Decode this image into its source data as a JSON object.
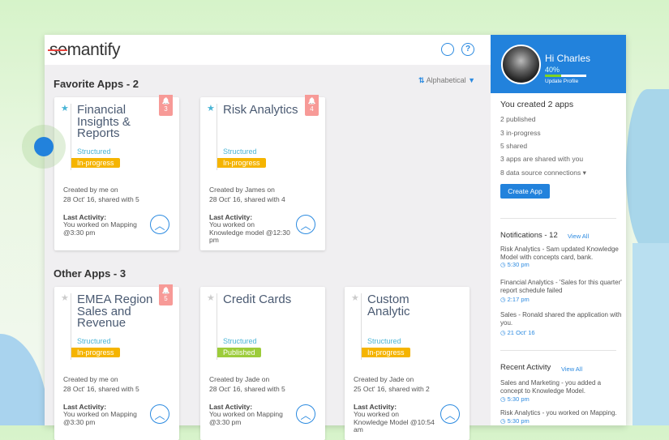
{
  "app": {
    "logo": "semantify",
    "logo_prefix": "se",
    "logo_suffix": "mantify"
  },
  "header": {
    "search_icon": "search-icon",
    "help_icon": "help-icon"
  },
  "favorites": {
    "title": "Favorite Apps - 2",
    "sort_label": "Alphabetical"
  },
  "other": {
    "title": "Other Apps - 3"
  },
  "colors": {
    "accent": "#2282dc",
    "inprogress": "#f5b400",
    "published": "#9ccc3a",
    "bell": "#f79a97"
  },
  "favorite_cards": [
    {
      "title": "Financial Insights & Reports",
      "type": "Structured",
      "status": "In-progress",
      "bell": "3",
      "created1": "Created by me on",
      "created2": "28 Oct' 16, shared with 5",
      "last_label": "Last Activity:",
      "last": "You worked on Mapping @3:30 pm",
      "starred": true
    },
    {
      "title": "Risk Analytics",
      "type": "Structured",
      "status": "In-progress",
      "bell": "4",
      "created1": "Created by James on",
      "created2": "28 Oct' 16, shared with 4",
      "last_label": "Last Activity:",
      "last": "You worked on Knowledge model @12:30 pm",
      "starred": true
    }
  ],
  "other_cards": [
    {
      "title": "EMEA Region Sales and Revenue",
      "type": "Structured",
      "status": "In-progress",
      "bell": "5",
      "created1": "Created by me on",
      "created2": "28 Oct' 16, shared with 5",
      "last_label": "Last Activity:",
      "last": "You worked on Mapping @3:30 pm",
      "starred": false
    },
    {
      "title": "Credit Cards",
      "type": "Structured",
      "status": "Published",
      "bell": null,
      "created1": "Created by Jade on",
      "created2": "28 Oct' 16, shared with 5",
      "last_label": "Last Activity:",
      "last": "You worked on Mapping @3:30 pm",
      "starred": false
    },
    {
      "title": "Custom Analytic",
      "type": "Structured",
      "status": "In-progress",
      "bell": null,
      "created1": "Created by Jade on",
      "created2": "25 Oct' 16, shared with 2",
      "last_label": "Last Activity:",
      "last": "You worked on Knowledge Model @10:54 am",
      "starred": false
    }
  ],
  "profile": {
    "greeting": "Hi Charles",
    "progress_label": "40%",
    "progress": 0.4,
    "update": "Update Profile"
  },
  "stats": {
    "title": "You created 2 apps",
    "items": [
      "2 published",
      "3 in-progress",
      "5 shared",
      "3 apps are shared with you",
      "8 data source connections ▾"
    ],
    "create": "Create App"
  },
  "notifications": {
    "title": "Notifications - 12",
    "view_all": "View All",
    "items": [
      {
        "text": "Risk Analytics - Sam updated Knowledge Model with concepts card, bank.",
        "time": "5:30 pm"
      },
      {
        "text": "Financial Analytics - 'Sales for this quarter' report schedule failed",
        "time": "2:17 pm"
      },
      {
        "text": "Sales - Ronald shared the application with you.",
        "time": "21 Oct' 16"
      }
    ]
  },
  "activity": {
    "title": "Recent Activity",
    "view_all": "View All",
    "items": [
      {
        "text": "Sales and Marketing  - you added a concept to Knowledge Model.",
        "time": "5:30 pm"
      },
      {
        "text": "Risk Analytics - you worked on Mapping.",
        "time": "5:30 pm"
      }
    ]
  }
}
